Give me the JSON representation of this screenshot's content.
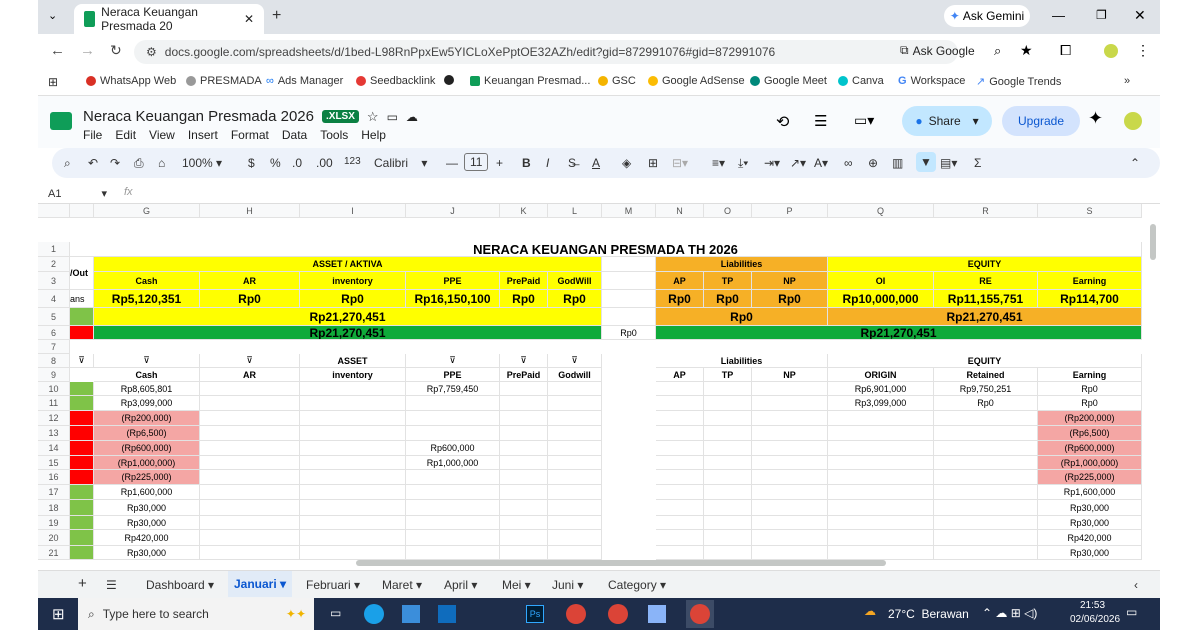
{
  "browser": {
    "tab_title": "Neraca Keuangan Presmada 20",
    "url": "docs.google.com/spreadsheets/d/1bed-L98RnPpxEw5YICLoXePptOE32AZh/edit?gid=872991076#gid=872991076",
    "ask_gemini": "Ask Gemini",
    "ask_google": "Ask Google",
    "bookmarks": [
      "WhatsApp Web",
      "PRESMADA",
      "Ads Manager",
      "Seedbacklink",
      "Keuangan Presmad...",
      "GSC",
      "Google AdSense",
      "Google Meet",
      "Canva",
      "Workspace",
      "Google Trends"
    ]
  },
  "doc": {
    "title": "Neraca Keuangan Presmada 2026",
    "badge": ".XLSX",
    "menus": [
      "File",
      "Edit",
      "View",
      "Insert",
      "Format",
      "Data",
      "Tools",
      "Help"
    ],
    "share": "Share",
    "upgrade": "Upgrade"
  },
  "toolbar": {
    "zoom": "100%",
    "currency": "$",
    "percent": "%",
    "dec_less": ".0",
    "dec_more": ".00",
    "number_fmt": "123",
    "font": "Calibri",
    "font_size": "11",
    "bold": "B",
    "italic": "I",
    "sum": "Σ"
  },
  "formula_bar": {
    "cell_ref": "A1",
    "fx": "fx"
  },
  "columns": [
    "G",
    "H",
    "I",
    "J",
    "K",
    "L",
    "M",
    "N",
    "O",
    "P",
    "Q",
    "R",
    "S"
  ],
  "rows": [
    "1",
    "2",
    "3",
    "4",
    "5",
    "6",
    "7",
    "8",
    "9",
    "10",
    "11",
    "12",
    "13",
    "14",
    "15",
    "16",
    "17",
    "18",
    "19",
    "20",
    "21"
  ],
  "sheet": {
    "title": "NERACA KEUANGAN PRESMADA TH 2026",
    "left_partial": {
      "r2": "/Out",
      "r4": "ans"
    },
    "asset_header": "ASSET / AKTIVA",
    "liab_header": "Liabilities",
    "equity_header": "EQUITY",
    "asset_cols": [
      "Cash",
      "AR",
      "inventory",
      "PPE",
      "PrePaid",
      "GodWill"
    ],
    "liab_cols": [
      "AP",
      "TP",
      "NP"
    ],
    "equity_cols": [
      "OI",
      "RE",
      "Earning"
    ],
    "asset_vals": [
      "Rp5,120,351",
      "Rp0",
      "Rp0",
      "Rp16,150,100",
      "Rp0",
      "Rp0"
    ],
    "liab_vals": [
      "Rp0",
      "Rp0",
      "Rp0"
    ],
    "equity_vals": [
      "Rp10,000,000",
      "Rp11,155,751",
      "Rp114,700"
    ],
    "asset_total": "Rp21,270,451",
    "liab_total": "Rp0",
    "equity_total": "Rp21,270,451",
    "asset_grand": "Rp21,270,451",
    "diff": "Rp0",
    "le_grand": "Rp21,270,451",
    "sub_asset_header": "ASSET",
    "sub_asset_cols": [
      "Cash",
      "AR",
      "inventory",
      "PPE",
      "PrePaid",
      "Godwill"
    ],
    "sub_liab_header": "Liabilities",
    "sub_liab_cols": [
      "AP",
      "TP",
      "NP"
    ],
    "sub_equity_header": "EQUITY",
    "sub_equity_cols": [
      "ORIGIN",
      "Retained",
      "Earning"
    ],
    "cash": [
      "Rp8,605,801",
      "Rp3,099,000",
      "(Rp200,000)",
      "(Rp6,500)",
      "(Rp600,000)",
      "(Rp1,000,000)",
      "(Rp225,000)",
      "Rp1,600,000",
      "Rp30,000",
      "Rp30,000",
      "Rp420,000",
      "Rp30,000"
    ],
    "ppe": {
      "r10": "Rp7,759,450",
      "r14": "Rp600,000",
      "r15": "Rp1,000,000"
    },
    "origin": {
      "r10": "Rp6,901,000",
      "r11": "Rp3,099,000"
    },
    "retained": {
      "r10": "Rp9,750,251",
      "r11": "Rp0"
    },
    "earning": [
      "Rp0",
      "Rp0",
      "(Rp200,000)",
      "(Rp6,500)",
      "(Rp600,000)",
      "(Rp1,000,000)",
      "(Rp225,000)",
      "Rp1,600,000",
      "Rp30,000",
      "Rp30,000",
      "Rp420,000",
      "Rp30,000"
    ]
  },
  "sheets": [
    "Dashboard",
    "Januari",
    "Februari",
    "Maret",
    "April",
    "Mei",
    "Juni",
    "Category"
  ],
  "active_sheet": "Januari",
  "taskbar": {
    "search": "Type here to search",
    "weather": "27°C  Berawan",
    "time": "21:53",
    "date": "02/06/2026"
  }
}
